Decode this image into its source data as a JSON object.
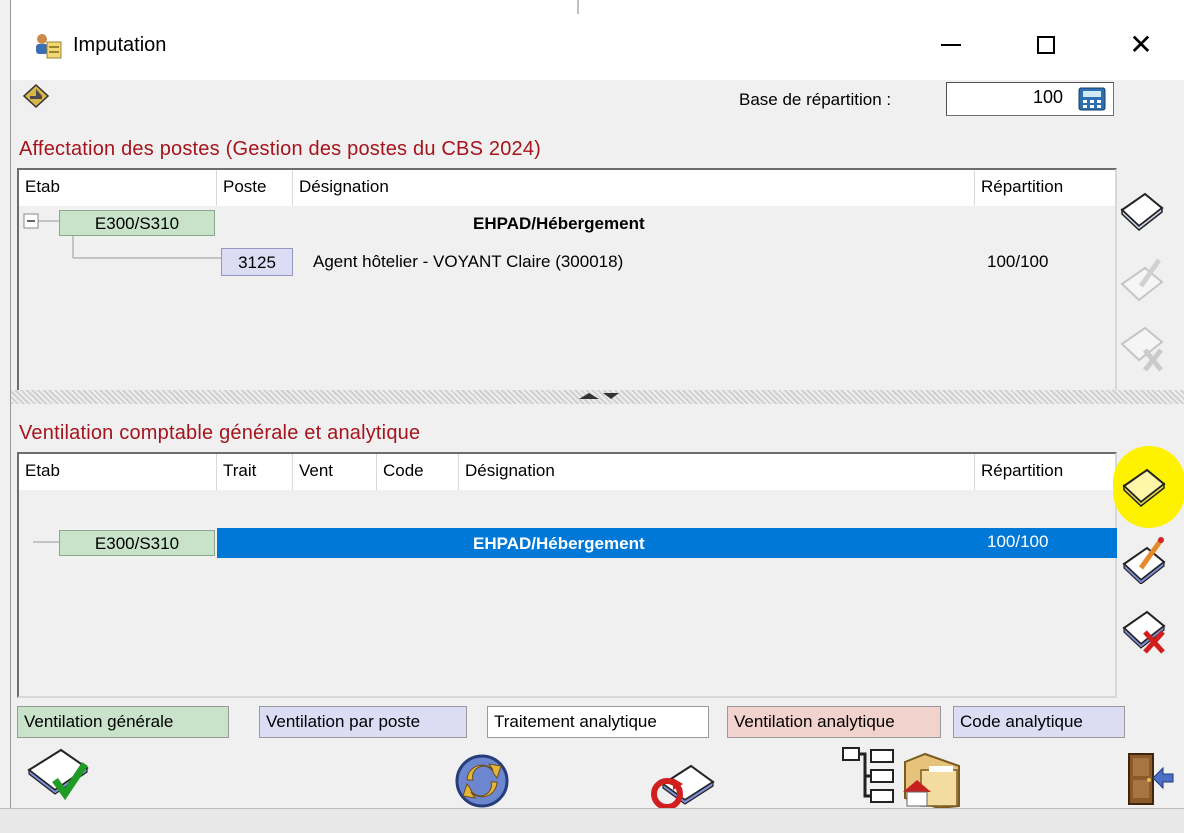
{
  "window": {
    "title": "Imputation"
  },
  "toolbar": {
    "base_label": "Base de répartition :",
    "base_value": "100"
  },
  "postes": {
    "title": "Affectation des postes (Gestion des postes du CBS 2024)",
    "columns": [
      "Etab",
      "Poste",
      "Désignation",
      "Répartition"
    ],
    "group": {
      "etab": "E300/S310",
      "designation": "EHPAD/Hébergement"
    },
    "rows": [
      {
        "poste": "3125",
        "designation": "Agent hôtelier - VOYANT Claire (300018)",
        "repartition": "100/100"
      }
    ]
  },
  "ventilation": {
    "title": "Ventilation comptable générale et analytique",
    "columns": [
      "Etab",
      "Trait",
      "Vent",
      "Code",
      "Désignation",
      "Répartition"
    ],
    "rows": [
      {
        "etab": "E300/S310",
        "designation": "EHPAD/Hébergement",
        "repartition": "100/100"
      }
    ],
    "selected_color": "#0078d7"
  },
  "legend": [
    {
      "label": "Ventilation générale",
      "color": "#c9e3cb"
    },
    {
      "label": "Ventilation par poste",
      "color": "#dcdcf4"
    },
    {
      "label": "Traitement analytique",
      "color": "#ffffff"
    },
    {
      "label": "Ventilation analytique",
      "color": "#f2d2cd"
    },
    {
      "label": "Code analytique",
      "color": "#dcdcf4"
    }
  ],
  "icons": {
    "side_postes": [
      "add-document-icon",
      "edit-document-icon",
      "delete-document-icon"
    ],
    "side_ventilation": [
      "add-document-icon",
      "edit-document-icon",
      "delete-document-icon"
    ],
    "bottom": [
      "validate-icon",
      "refresh-icon",
      "reset-icon",
      "tree-icon",
      "folder-home-icon",
      "exit-door-icon"
    ]
  }
}
